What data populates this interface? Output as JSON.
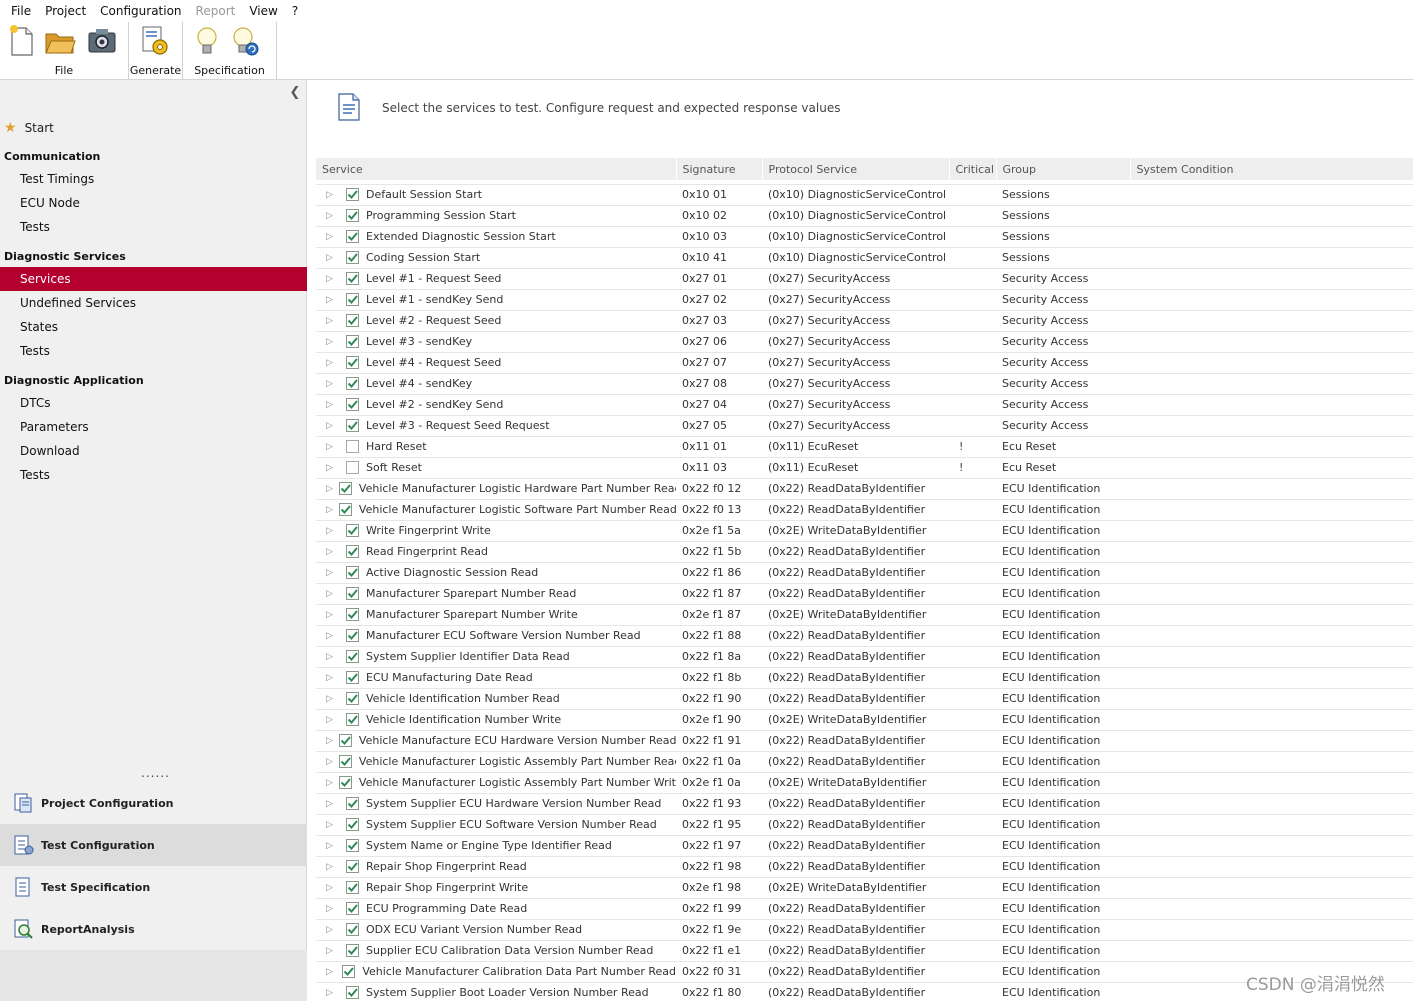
{
  "menu": [
    "File",
    "Project",
    "Configuration",
    "Report",
    "View",
    "?"
  ],
  "menu_disabled": [
    "Report"
  ],
  "ribbon": {
    "groups": [
      {
        "label": "File",
        "icons": [
          "new-file-icon",
          "open-folder-icon",
          "camera-icon"
        ]
      },
      {
        "label": "Generate",
        "icons": [
          "generate-gear-icon"
        ]
      },
      {
        "label": "Specification",
        "icons": [
          "lightbulb-icon",
          "lightbulb-refresh-icon"
        ]
      }
    ]
  },
  "sidebar": {
    "start": "Start",
    "sections": [
      {
        "title": "Communication",
        "items": [
          "Test Timings",
          "ECU Node",
          "Tests"
        ]
      },
      {
        "title": "Diagnostic  Services",
        "items": [
          "Services",
          "Undefined Services",
          "States",
          "Tests"
        ]
      },
      {
        "title": "Diagnostic  Application",
        "items": [
          "DTCs",
          "Parameters",
          "Download",
          "Tests"
        ]
      }
    ],
    "active_item": "Services",
    "dots": "......",
    "bottom_nav": [
      "Project Configuration",
      "Test Configuration",
      "Test Specification",
      "ReportAnalysis"
    ],
    "bottom_active": "Test Configuration"
  },
  "main": {
    "instruction": "Select the services to test. Configure request and expected response values",
    "columns": [
      "Service",
      "Signature",
      "Protocol Service",
      "Critical",
      "Group",
      "System Condition"
    ],
    "rows": [
      {
        "service": "Default Session Start",
        "signature": "0x10 01",
        "protocol": "(0x10) DiagnosticServiceControl",
        "critical": "",
        "group": "Sessions",
        "checked": true
      },
      {
        "service": "Programming Session Start",
        "signature": "0x10 02",
        "protocol": "(0x10) DiagnosticServiceControl",
        "critical": "",
        "group": "Sessions",
        "checked": true
      },
      {
        "service": "Extended Diagnostic Session Start",
        "signature": "0x10 03",
        "protocol": "(0x10) DiagnosticServiceControl",
        "critical": "",
        "group": "Sessions",
        "checked": true
      },
      {
        "service": "Coding Session Start",
        "signature": "0x10 41",
        "protocol": "(0x10) DiagnosticServiceControl",
        "critical": "",
        "group": "Sessions",
        "checked": true
      },
      {
        "service": "Level #1 - Request Seed",
        "signature": "0x27 01",
        "protocol": "(0x27) SecurityAccess",
        "critical": "",
        "group": "Security Access",
        "checked": true
      },
      {
        "service": "Level #1 - sendKey Send",
        "signature": "0x27 02",
        "protocol": "(0x27) SecurityAccess",
        "critical": "",
        "group": "Security Access",
        "checked": true
      },
      {
        "service": "Level #2 - Request Seed",
        "signature": "0x27 03",
        "protocol": "(0x27) SecurityAccess",
        "critical": "",
        "group": "Security Access",
        "checked": true
      },
      {
        "service": "Level #3 - sendKey",
        "signature": "0x27 06",
        "protocol": "(0x27) SecurityAccess",
        "critical": "",
        "group": "Security Access",
        "checked": true
      },
      {
        "service": "Level #4 - Request Seed",
        "signature": "0x27 07",
        "protocol": "(0x27) SecurityAccess",
        "critical": "",
        "group": "Security Access",
        "checked": true
      },
      {
        "service": "Level #4 - sendKey",
        "signature": "0x27 08",
        "protocol": "(0x27) SecurityAccess",
        "critical": "",
        "group": "Security Access",
        "checked": true
      },
      {
        "service": "Level #2 - sendKey Send",
        "signature": "0x27 04",
        "protocol": "(0x27) SecurityAccess",
        "critical": "",
        "group": "Security Access",
        "checked": true
      },
      {
        "service": "Level #3 - Request Seed Request",
        "signature": "0x27 05",
        "protocol": "(0x27) SecurityAccess",
        "critical": "",
        "group": "Security Access",
        "checked": true
      },
      {
        "service": "Hard Reset",
        "signature": "0x11 01",
        "protocol": "(0x11) EcuReset",
        "critical": "!",
        "group": "Ecu Reset",
        "checked": false
      },
      {
        "service": "Soft Reset",
        "signature": "0x11 03",
        "protocol": "(0x11) EcuReset",
        "critical": "!",
        "group": "Ecu Reset",
        "checked": false
      },
      {
        "service": "Vehicle Manufacturer Logistic Hardware Part Number Read",
        "signature": "0x22 f0 12",
        "protocol": "(0x22) ReadDataByIdentifier",
        "critical": "",
        "group": "ECU Identification",
        "checked": true
      },
      {
        "service": "Vehicle Manufacturer Logistic Software Part Number Read",
        "signature": "0x22 f0 13",
        "protocol": "(0x22) ReadDataByIdentifier",
        "critical": "",
        "group": "ECU Identification",
        "checked": true
      },
      {
        "service": "Write Fingerprint Write",
        "signature": "0x2e f1 5a",
        "protocol": "(0x2E) WriteDataByIdentifier",
        "critical": "",
        "group": "ECU Identification",
        "checked": true
      },
      {
        "service": "Read Fingerprint Read",
        "signature": "0x22 f1 5b",
        "protocol": "(0x22) ReadDataByIdentifier",
        "critical": "",
        "group": "ECU Identification",
        "checked": true
      },
      {
        "service": "Active Diagnostic Session Read",
        "signature": "0x22 f1 86",
        "protocol": "(0x22) ReadDataByIdentifier",
        "critical": "",
        "group": "ECU Identification",
        "checked": true
      },
      {
        "service": "Manufacturer Sparepart Number Read",
        "signature": "0x22 f1 87",
        "protocol": "(0x22) ReadDataByIdentifier",
        "critical": "",
        "group": "ECU Identification",
        "checked": true
      },
      {
        "service": "Manufacturer Sparepart Number Write",
        "signature": "0x2e f1 87",
        "protocol": "(0x2E) WriteDataByIdentifier",
        "critical": "",
        "group": "ECU Identification",
        "checked": true
      },
      {
        "service": "Manufacturer ECU Software Version Number Read",
        "signature": "0x22 f1 88",
        "protocol": "(0x22) ReadDataByIdentifier",
        "critical": "",
        "group": "ECU Identification",
        "checked": true
      },
      {
        "service": "System Supplier Identifier Data Read",
        "signature": "0x22 f1 8a",
        "protocol": "(0x22) ReadDataByIdentifier",
        "critical": "",
        "group": "ECU Identification",
        "checked": true
      },
      {
        "service": "ECU Manufacturing Date Read",
        "signature": "0x22 f1 8b",
        "protocol": "(0x22) ReadDataByIdentifier",
        "critical": "",
        "group": "ECU Identification",
        "checked": true
      },
      {
        "service": "Vehicle Identification Number Read",
        "signature": "0x22 f1 90",
        "protocol": "(0x22) ReadDataByIdentifier",
        "critical": "",
        "group": "ECU Identification",
        "checked": true
      },
      {
        "service": "Vehicle Identification Number Write",
        "signature": "0x2e f1 90",
        "protocol": "(0x2E) WriteDataByIdentifier",
        "critical": "",
        "group": "ECU Identification",
        "checked": true
      },
      {
        "service": "Vehicle Manufacture ECU Hardware Version Number Read",
        "signature": "0x22 f1 91",
        "protocol": "(0x22) ReadDataByIdentifier",
        "critical": "",
        "group": "ECU Identification",
        "checked": true
      },
      {
        "service": "Vehicle Manufacturer Logistic Assembly Part Number Read",
        "signature": "0x22 f1 0a",
        "protocol": "(0x22) ReadDataByIdentifier",
        "critical": "",
        "group": "ECU Identification",
        "checked": true
      },
      {
        "service": "Vehicle Manufacturer Logistic Assembly Part Number Write",
        "signature": "0x2e f1 0a",
        "protocol": "(0x2E) WriteDataByIdentifier",
        "critical": "",
        "group": "ECU Identification",
        "checked": true
      },
      {
        "service": "System Supplier ECU Hardware Version Number  Read",
        "signature": "0x22 f1 93",
        "protocol": "(0x22) ReadDataByIdentifier",
        "critical": "",
        "group": "ECU Identification",
        "checked": true
      },
      {
        "service": "System Supplier ECU Software Version Number Read",
        "signature": "0x22 f1 95",
        "protocol": "(0x22) ReadDataByIdentifier",
        "critical": "",
        "group": "ECU Identification",
        "checked": true
      },
      {
        "service": "System Name or Engine Type Identifier Read",
        "signature": "0x22 f1 97",
        "protocol": "(0x22) ReadDataByIdentifier",
        "critical": "",
        "group": "ECU Identification",
        "checked": true
      },
      {
        "service": "Repair Shop Fingerprint Read",
        "signature": "0x22 f1 98",
        "protocol": "(0x22) ReadDataByIdentifier",
        "critical": "",
        "group": "ECU Identification",
        "checked": true
      },
      {
        "service": "Repair Shop Fingerprint Write",
        "signature": "0x2e f1 98",
        "protocol": "(0x2E) WriteDataByIdentifier",
        "critical": "",
        "group": "ECU Identification",
        "checked": true
      },
      {
        "service": "ECU Programming Date Read",
        "signature": "0x22 f1 99",
        "protocol": "(0x22) ReadDataByIdentifier",
        "critical": "",
        "group": "ECU Identification",
        "checked": true
      },
      {
        "service": "ODX ECU Variant Version Number Read",
        "signature": "0x22 f1 9e",
        "protocol": "(0x22) ReadDataByIdentifier",
        "critical": "",
        "group": "ECU Identification",
        "checked": true
      },
      {
        "service": "Supplier ECU Calibration Data Version Number Read",
        "signature": "0x22 f1 e1",
        "protocol": "(0x22) ReadDataByIdentifier",
        "critical": "",
        "group": "ECU Identification",
        "checked": true
      },
      {
        "service": "Vehicle Manufacturer Calibration Data Part Number Read",
        "signature": "0x22 f0 31",
        "protocol": "(0x22) ReadDataByIdentifier",
        "critical": "",
        "group": "ECU Identification",
        "checked": true
      },
      {
        "service": "System Supplier Boot Loader Version Number Read",
        "signature": "0x22 f1 80",
        "protocol": "(0x22) ReadDataByIdentifier",
        "critical": "",
        "group": "ECU Identification",
        "checked": true
      }
    ]
  },
  "watermark": "CSDN @涓涓悦然",
  "colors": {
    "accent": "#b4002f",
    "check": "#2e8b57",
    "header_bg": "#eeeeee"
  }
}
